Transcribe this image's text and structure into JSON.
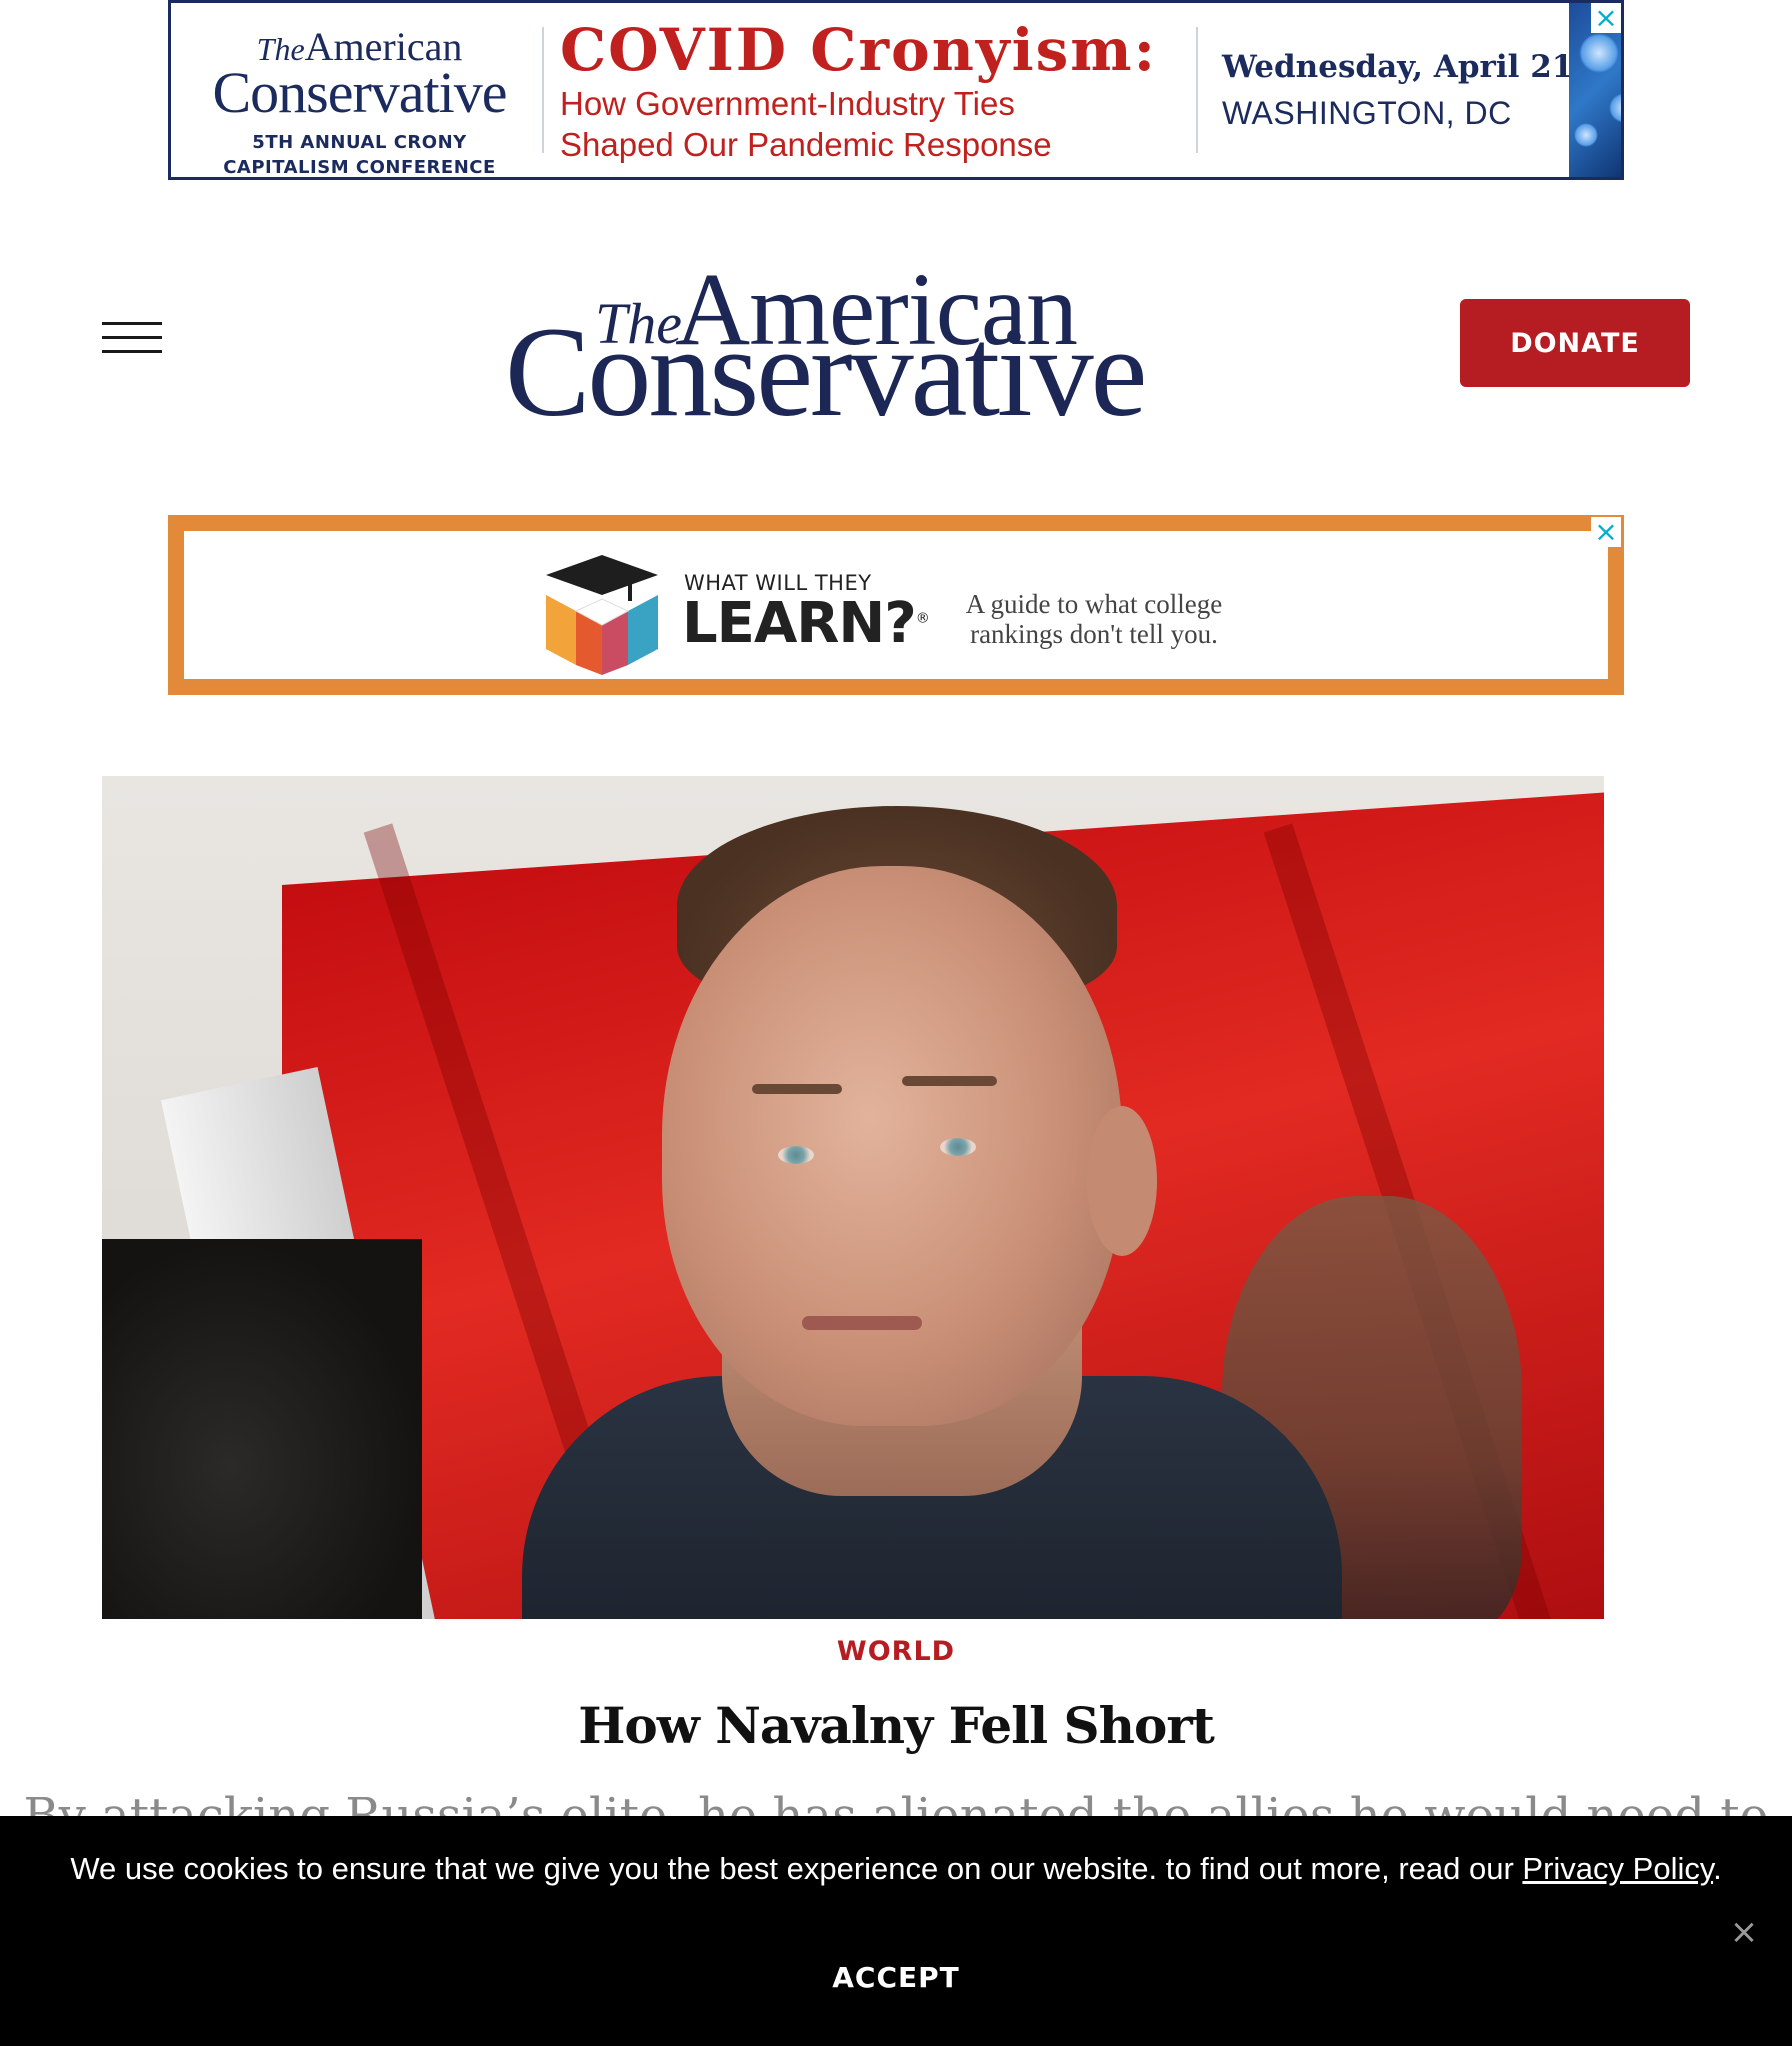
{
  "ads": {
    "top": {
      "brand_the": "The",
      "brand_american": "American",
      "brand_conservative": "Conservative",
      "brand_sub_line1": "5TH ANNUAL CRONY",
      "brand_sub_line2": "CAPITALISM CONFERENCE",
      "headline": "COVID Cronyism:",
      "subheadline_line1": "How Government-Industry Ties",
      "subheadline_line2": "Shaped Our Pandemic Response",
      "date": "Wednesday, April 21",
      "location": "WASHINGTON, DC",
      "close_icon": "×"
    },
    "mid": {
      "question_small": "WHAT WILL THEY",
      "question_big": "LEARN?",
      "registered": "®",
      "tagline_line1": "A guide to what college",
      "tagline_line2": "rankings don't tell you.",
      "close_icon": "×"
    }
  },
  "header": {
    "menu_icon": "hamburger-icon",
    "logo_the": "The",
    "logo_american": "American",
    "logo_conservative": "Conservative",
    "donate_label": "DONATE"
  },
  "article": {
    "category": "WORLD",
    "title": "How Navalny Fell Short",
    "dek": "By attacking Russia’s elite, he has alienated the allies he would need to"
  },
  "cookie": {
    "message": "We use cookies to ensure that we give you the best experience on our website. to find out more, read our ",
    "policy_link": "Privacy Policy",
    "period": ".",
    "accept_label": "ACCEPT",
    "close_icon": "×"
  },
  "colors": {
    "brand_navy": "#1c2755",
    "accent_red": "#b51d22",
    "ad_orange": "#e2893a",
    "cookie_bg": "#000000"
  }
}
